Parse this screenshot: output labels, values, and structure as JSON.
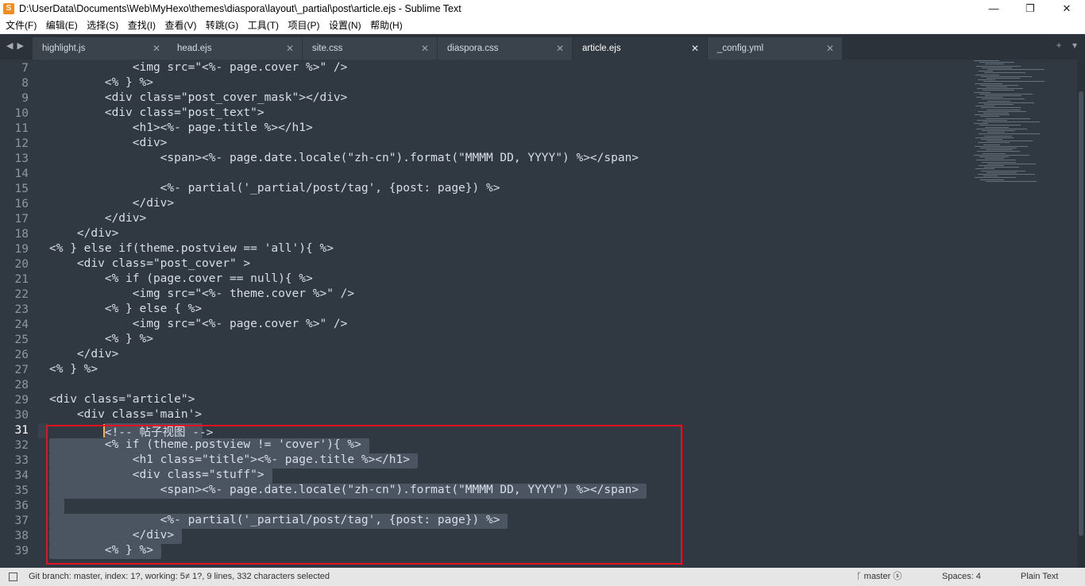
{
  "window": {
    "title": "D:\\UserData\\Documents\\Web\\MyHexo\\themes\\diaspora\\layout\\_partial\\post\\article.ejs - Sublime Text",
    "minimize": "—",
    "maximize": "❐",
    "close": "✕"
  },
  "menu": [
    "文件(F)",
    "编辑(E)",
    "选择(S)",
    "查找(I)",
    "查看(V)",
    "转跳(G)",
    "工具(T)",
    "项目(P)",
    "设置(N)",
    "帮助(H)"
  ],
  "tabs": [
    {
      "label": "highlight.js",
      "active": false
    },
    {
      "label": "head.ejs",
      "active": false
    },
    {
      "label": "site.css",
      "active": false
    },
    {
      "label": "diaspora.css",
      "active": false
    },
    {
      "label": "article.ejs",
      "active": true
    },
    {
      "label": "_config.yml",
      "active": false
    }
  ],
  "tab_close_glyph": "✕",
  "nav_arrows": "◀ ▶",
  "tabbar_right": [
    "+",
    "▾"
  ],
  "editor": {
    "current_line": 31,
    "lines": [
      {
        "n": "7",
        "text": "            <img src=\"<%- page.cover %>\" />"
      },
      {
        "n": "8",
        "text": "        <% } %>"
      },
      {
        "n": "9",
        "text": "        <div class=\"post_cover_mask\"></div>"
      },
      {
        "n": "10",
        "text": "        <div class=\"post_text\">"
      },
      {
        "n": "11",
        "text": "            <h1><%- page.title %></h1>"
      },
      {
        "n": "12",
        "text": "            <div>"
      },
      {
        "n": "13",
        "text": "                <span><%- page.date.locale(\"zh-cn\").format(\"MMMM DD, YYYY\") %></span>"
      },
      {
        "n": "14",
        "text": ""
      },
      {
        "n": "15",
        "text": "                <%- partial('_partial/post/tag', {post: page}) %>"
      },
      {
        "n": "16",
        "text": "            </div>"
      },
      {
        "n": "17",
        "text": "        </div>"
      },
      {
        "n": "18",
        "text": "    </div>"
      },
      {
        "n": "19",
        "text": "<% } else if(theme.postview == 'all'){ %>"
      },
      {
        "n": "20",
        "text": "    <div class=\"post_cover\" >"
      },
      {
        "n": "21",
        "text": "        <% if (page.cover == null){ %>"
      },
      {
        "n": "22",
        "text": "            <img src=\"<%- theme.cover %>\" />"
      },
      {
        "n": "23",
        "text": "        <% } else { %>"
      },
      {
        "n": "24",
        "text": "            <img src=\"<%- page.cover %>\" />"
      },
      {
        "n": "25",
        "text": "        <% } %>"
      },
      {
        "n": "26",
        "text": "    </div>"
      },
      {
        "n": "27",
        "text": "<% } %>"
      },
      {
        "n": "28",
        "text": ""
      },
      {
        "n": "29",
        "text": "<div class=\"article\">"
      },
      {
        "n": "30",
        "text": "    <div class='main'>"
      },
      {
        "n": "31",
        "text": "        <!-- 帖子视图 -->"
      },
      {
        "n": "32",
        "text": "        <% if (theme.postview != 'cover'){ %>"
      },
      {
        "n": "33",
        "text": "            <h1 class=\"title\"><%- page.title %></h1>"
      },
      {
        "n": "34",
        "text": "            <div class=\"stuff\">"
      },
      {
        "n": "35",
        "text": "                <span><%- page.date.locale(\"zh-cn\").format(\"MMMM DD, YYYY\") %></span>"
      },
      {
        "n": "36",
        "text": ""
      },
      {
        "n": "37",
        "text": "                <%- partial('_partial/post/tag', {post: page}) %>"
      },
      {
        "n": "38",
        "text": "            </div>"
      },
      {
        "n": "39",
        "text": "        <% } %>"
      }
    ]
  },
  "status": {
    "left": "Git branch: master, index: 1?, working: 5≠ 1?, 9 lines, 332 characters selected",
    "branch": "ᚴ master ⓢ",
    "spaces": "Spaces: 4",
    "syntax": "Plain Text"
  },
  "colors": {
    "background": "#303841",
    "selection_box": "#e81123",
    "cursor": "#f9ae58"
  }
}
